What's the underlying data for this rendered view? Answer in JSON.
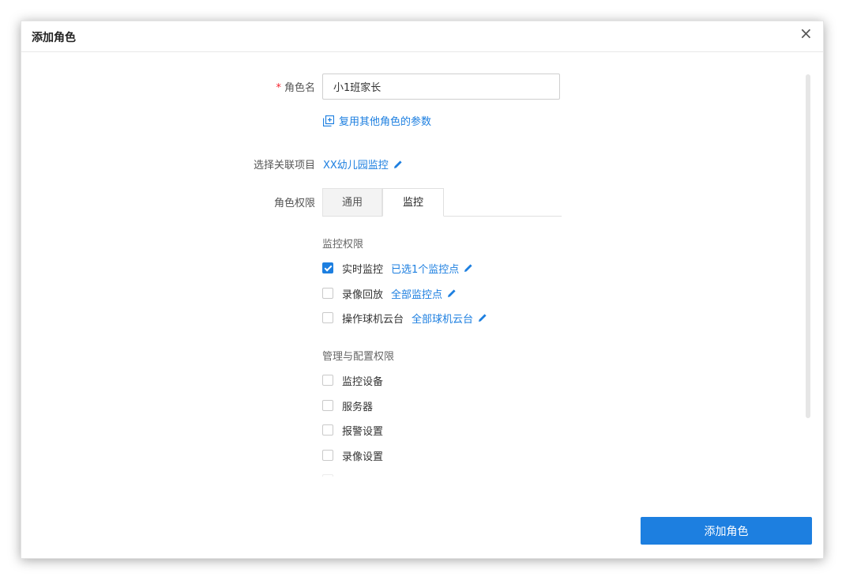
{
  "dialog": {
    "title": "添加角色",
    "close_icon": "close-icon",
    "submit_label": "添加角色"
  },
  "form": {
    "role_name": {
      "required_mark": "*",
      "label": "角色名",
      "value": "小1班家长"
    },
    "reuse_link": "复用其他角色的参数",
    "project": {
      "label": "选择关联项目",
      "value": "XX幼儿园监控"
    },
    "permissions": {
      "label": "角色权限",
      "tabs": [
        {
          "label": "通用",
          "active": false
        },
        {
          "label": "监控",
          "active": true
        }
      ]
    }
  },
  "monitor_section": {
    "title": "监控权限",
    "items": [
      {
        "label": "实时监控",
        "checked": true,
        "link": "已选1个监控点"
      },
      {
        "label": "录像回放",
        "checked": false,
        "link": "全部监控点"
      },
      {
        "label": "操作球机云台",
        "checked": false,
        "link": "全部球机云台"
      }
    ]
  },
  "manage_section": {
    "title": "管理与配置权限",
    "items": [
      {
        "label": "监控设备",
        "checked": false
      },
      {
        "label": "服务器",
        "checked": false
      },
      {
        "label": "报警设置",
        "checked": false
      },
      {
        "label": "录像设置",
        "checked": false
      },
      {
        "label": "",
        "checked": false
      }
    ]
  },
  "colors": {
    "accent": "#1d7fe0",
    "required": "#f5222d"
  }
}
